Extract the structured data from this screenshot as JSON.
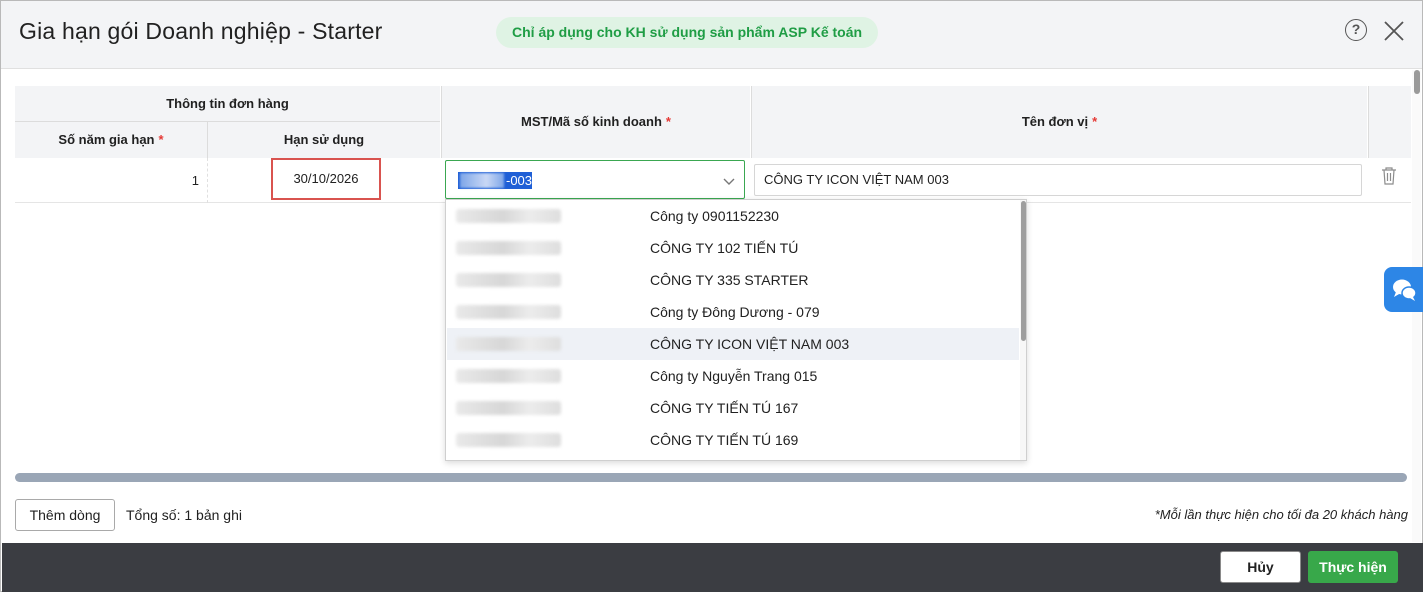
{
  "dialog": {
    "title": "Gia hạn gói Doanh nghiệp - Starter",
    "note": "Chỉ áp dụng cho KH sử dụng sản phẩm ASP Kế toán",
    "help_icon": "question-circle-icon",
    "close_icon": "close-icon"
  },
  "table": {
    "group_header": "Thông tin đơn hàng",
    "columns": {
      "years": "Số năm gia hạn",
      "expiry": "Hạn sử dụng",
      "mst": "MST/Mã số kinh doanh",
      "name": "Tên đơn vị",
      "required_mark": "*"
    },
    "row": {
      "years": "1",
      "expiry": "30/10/2026",
      "mst_value": "-003",
      "name": "CÔNG TY ICON VIỆT NAM 003"
    }
  },
  "dropdown": {
    "items": [
      {
        "name": "Công ty 0901152230",
        "selected": false
      },
      {
        "name": "CÔNG TY 102 TIẾN TÚ",
        "selected": false
      },
      {
        "name": "CÔNG TY 335 STARTER",
        "selected": false
      },
      {
        "name": "Công ty Đông Dương - 079",
        "selected": false
      },
      {
        "name": "CÔNG TY ICON VIỆT NAM 003",
        "selected": true
      },
      {
        "name": "Công ty Nguyễn Trang 015",
        "selected": false
      },
      {
        "name": "CÔNG TY TIẾN TÚ 167",
        "selected": false
      },
      {
        "name": "CÔNG TY TIẾN TÚ 169",
        "selected": false
      }
    ]
  },
  "footer_bar": {
    "add_row": "Thêm dòng",
    "total": "Tổng số: 1 bản ghi",
    "limit_note": "*Mỗi lần thực hiện cho tối đa 20 khách hàng"
  },
  "actions": {
    "cancel": "Hủy",
    "submit": "Thực hiện"
  },
  "colors": {
    "accent_green": "#38a84a",
    "pill_bg": "#dff3e4",
    "chat_blue": "#2d86e6",
    "footer_dark": "#3b3d42"
  }
}
